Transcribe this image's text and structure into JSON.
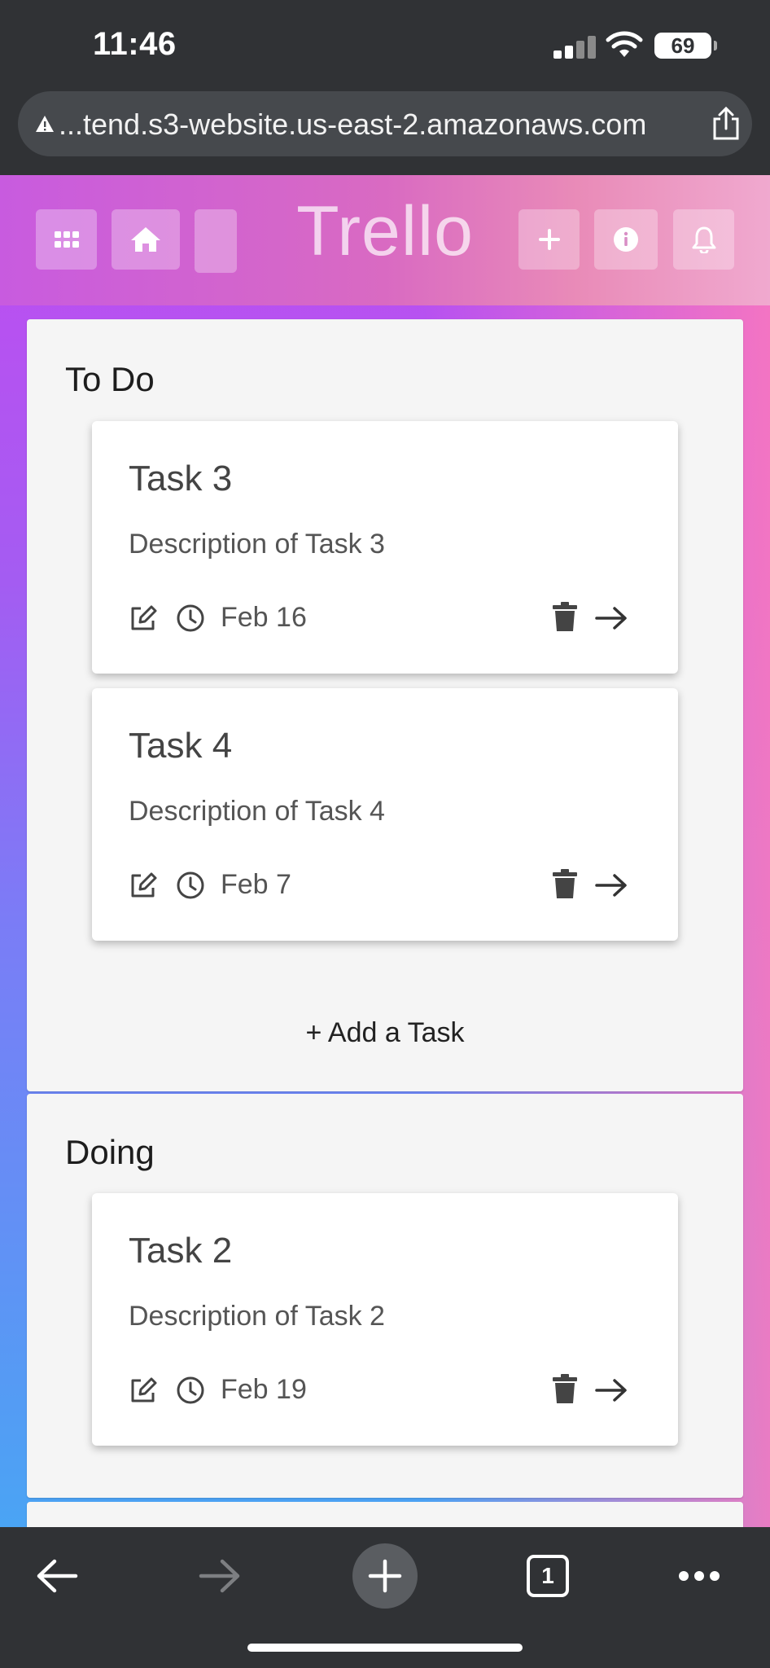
{
  "status_bar": {
    "time": "11:46",
    "battery": "69"
  },
  "browser": {
    "url": "...tend.s3-website.us-east-2.amazonaws.com"
  },
  "app": {
    "brand": "Trello"
  },
  "lists": [
    {
      "title": "To Do",
      "cards": [
        {
          "title": "Task 3",
          "description": "Description of Task 3",
          "date": "Feb 16"
        },
        {
          "title": "Task 4",
          "description": "Description of Task 4",
          "date": "Feb 7"
        }
      ],
      "add_label": "+ Add a Task"
    },
    {
      "title": "Doing",
      "cards": [
        {
          "title": "Task 2",
          "description": "Description of Task 2",
          "date": "Feb 19"
        }
      ]
    }
  ],
  "toolbar": {
    "tab_count": "1"
  }
}
